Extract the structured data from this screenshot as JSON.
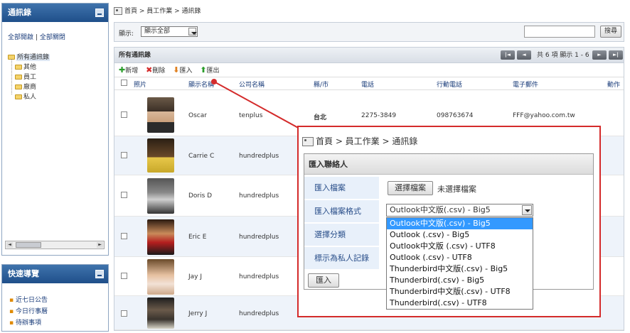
{
  "sidebar": {
    "contacts_panel": {
      "title": "通訊錄",
      "expand_all": "全部開啟",
      "separator": "|",
      "collapse_all": "全部關閉",
      "root": "所有通訊錄",
      "folders": [
        "其他",
        "員工",
        "廠商",
        "私人"
      ]
    },
    "quick_nav": {
      "title": "快速導覽",
      "items": [
        "近七日公告",
        "今日行事曆",
        "待辦事項"
      ]
    }
  },
  "breadcrumb": "首頁 > 員工作業 > 通訊錄",
  "filter": {
    "label": "顯示:",
    "selected": "顯示全部",
    "search_button": "搜尋"
  },
  "grid": {
    "title": "所有通訊錄",
    "paging": "共 6 項 顯示 1 - 6",
    "toolbar": {
      "add": "新增",
      "delete": "刪除",
      "import": "匯入",
      "export": "匯出"
    },
    "columns": [
      "照片",
      "顯示名稱",
      "公司名稱",
      "縣/市",
      "電話",
      "行動電話",
      "電子郵件",
      "動作"
    ],
    "rows": [
      {
        "name": "Oscar",
        "company": "tenplus",
        "city": "台北",
        "phone": "2275-3849",
        "mobile": "098763674",
        "email": "FFF@yahoo.com.tw"
      },
      {
        "name": "Carrie C",
        "company": "hundredplus",
        "city": "",
        "phone": "",
        "mobile": "",
        "email": ""
      },
      {
        "name": "Doris D",
        "company": "hundredplus",
        "city": "",
        "phone": "",
        "mobile": "",
        "email": ""
      },
      {
        "name": "Eric E",
        "company": "hundredplus",
        "city": "",
        "phone": "",
        "mobile": "",
        "email": ""
      },
      {
        "name": "Jay J",
        "company": "hundredplus",
        "city": "",
        "phone": "",
        "mobile": "",
        "email": ""
      },
      {
        "name": "Jerry J",
        "company": "hundredplus",
        "city": "",
        "phone": "",
        "mobile": "",
        "email": ""
      }
    ]
  },
  "import_dialog": {
    "breadcrumb": "首頁 > 員工作業 > 通訊錄",
    "title": "匯入聯絡人",
    "labels": [
      "匯入檔案",
      "匯入檔案格式",
      "選擇分類",
      "標示為私人記錄"
    ],
    "choose_file_button": "選擇檔案",
    "no_file": "未選擇檔案",
    "format_selected": "Outlook中文版(.csv) - Big5",
    "format_options": [
      "Outlook中文版(.csv) - Big5",
      "Outlook (.csv) - Big5",
      "Outlook中文版 (.csv) - UTF8",
      "Outlook (.csv) - UTF8",
      "Thunderbird中文版(.csv) - Big5",
      "Thunderbird(.csv) - Big5",
      "Thunderbird中文版(.csv) - UTF8",
      "Thunderbird(.csv) - UTF8"
    ],
    "import_button": "匯入"
  },
  "colors": {
    "accent": "#d42b2b",
    "header_blue": "#1f4f8a",
    "selected_option": "#3399ff"
  }
}
